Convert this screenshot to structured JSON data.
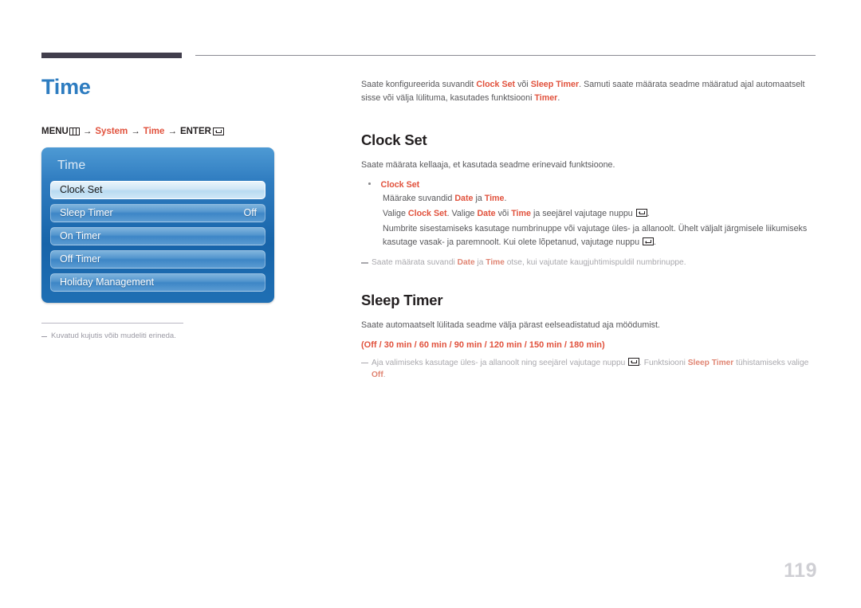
{
  "page": {
    "title": "Time",
    "number": "119"
  },
  "breadcrumb": {
    "menu_label": "MENU",
    "menu_icon": "menu-bars-icon",
    "arrow": "→",
    "item1": "System",
    "item2": "Time",
    "enter_label": "ENTER",
    "enter_icon": "enter-return-icon"
  },
  "osd": {
    "title": "Time",
    "rows": [
      {
        "label": "Clock Set",
        "value": "",
        "selected": true
      },
      {
        "label": "Sleep Timer",
        "value": "Off",
        "selected": false
      },
      {
        "label": "On Timer",
        "value": "",
        "selected": false
      },
      {
        "label": "Off Timer",
        "value": "",
        "selected": false
      },
      {
        "label": "Holiday Management",
        "value": "",
        "selected": false
      }
    ]
  },
  "left_footnote": {
    "text": "Kuvatud kujutis võib mudeliti erineda."
  },
  "intro": {
    "p1_a": "Saate konfigureerida suvandit ",
    "p1_b1": "Clock Set",
    "p1_c": " või ",
    "p1_b2": "Sleep Timer",
    "p1_d": ". Samuti saate määrata seadme määratud ajal automaatselt sisse või välja lülituma, kasutades funktsiooni ",
    "p1_b3": "Timer",
    "p1_e": "."
  },
  "clock_set": {
    "heading": "Clock Set",
    "intro": "Saate määrata kellaaja, et kasutada seadme erinevaid funktsioone.",
    "bullet_label": "Clock Set",
    "line1_a": "Määrake suvandid ",
    "line1_b1": "Date",
    "line1_c": " ja ",
    "line1_b2": "Time",
    "line1_d": ".",
    "line2_a": "Valige ",
    "line2_b1": "Clock Set",
    "line2_c": ". Valige ",
    "line2_b2": "Date",
    "line2_d": " või ",
    "line2_b3": "Time",
    "line2_e": " ja seejärel vajutage nuppu ",
    "line2_f": ".",
    "line3_a": "Numbrite sisestamiseks kasutage numbrinuppe või vajutage üles- ja allanoolt. Ühelt väljalt järgmisele liikumiseks kasutage vasak- ja paremnoolt. Kui olete lõpetanud, vajutage nuppu ",
    "line3_b": ".",
    "note_a": "Saate määrata suvandi ",
    "note_b1": "Date",
    "note_c": " ja ",
    "note_b2": "Time",
    "note_d": " otse, kui vajutate kaugjuhtimispuldil numbrinuppe."
  },
  "sleep_timer": {
    "heading": "Sleep Timer",
    "intro": "Saate automaatselt lülitada seadme välja pärast eelseadistatud aja möödumist.",
    "options": "(Off / 30 min / 60 min / 90 min / 120 min / 150 min / 180 min)",
    "note_a": "Aja valimiseks kasutage üles- ja allanoolt ning seejärel vajutage nuppu ",
    "note_b": ". Funktsiooni ",
    "note_c1": "Sleep Timer",
    "note_d": " tühistamiseks valige ",
    "note_c2": "Off",
    "note_e": "."
  },
  "colors": {
    "accent_blue": "#2d7cc0",
    "accent_orange": "#e1523d",
    "rule_dark": "#413e4c",
    "osd_blue": "#1764a9",
    "page_number": "#cfcfd4"
  }
}
